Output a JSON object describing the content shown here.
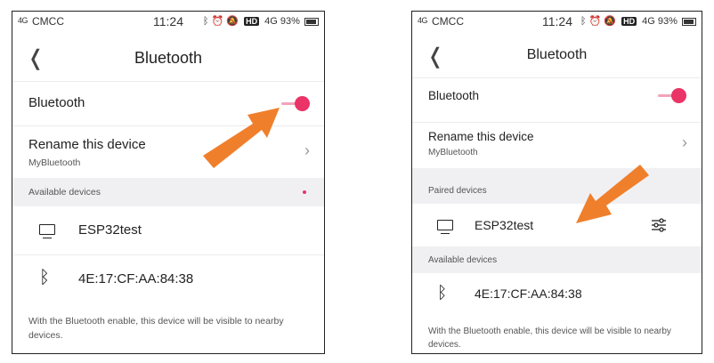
{
  "colors": {
    "accent": "#ea3366",
    "arrow": "#f07f2c",
    "section_bg": "#f0f0f3"
  },
  "left": {
    "status": {
      "signal": "4G",
      "carrier": "CMCC",
      "time": "11:24",
      "hd": "HD",
      "network": "4G",
      "battery": "93%"
    },
    "header": {
      "title": "Bluetooth"
    },
    "bluetooth_label": "Bluetooth",
    "bluetooth_on": true,
    "rename": {
      "label": "Rename this device",
      "value": "MyBluetooth"
    },
    "available_label": "Available devices",
    "devices": [
      {
        "name": "ESP32test",
        "icon": "monitor-icon"
      },
      {
        "name": "4E:17:CF:AA:84:38",
        "icon": "bluetooth-icon"
      }
    ],
    "footer": "With the Bluetooth enable, this device will be visible to nearby devices."
  },
  "right": {
    "status": {
      "signal": "4G",
      "carrier": "CMCC",
      "time": "11:24",
      "hd": "HD",
      "network": "4G",
      "battery": "93%"
    },
    "header": {
      "title": "Bluetooth"
    },
    "bluetooth_label": "Bluetooth",
    "bluetooth_on": true,
    "rename": {
      "label": "Rename this device",
      "value": "MyBluetooth"
    },
    "paired_label": "Paired devices",
    "paired_device": {
      "name": "ESP32test",
      "icon": "monitor-icon",
      "settings_icon": "sliders-icon"
    },
    "available_label": "Available devices",
    "available_device": {
      "name": "4E:17:CF:AA:84:38",
      "icon": "bluetooth-icon"
    },
    "footer": "With the Bluetooth enable, this device will be visible to nearby devices."
  }
}
